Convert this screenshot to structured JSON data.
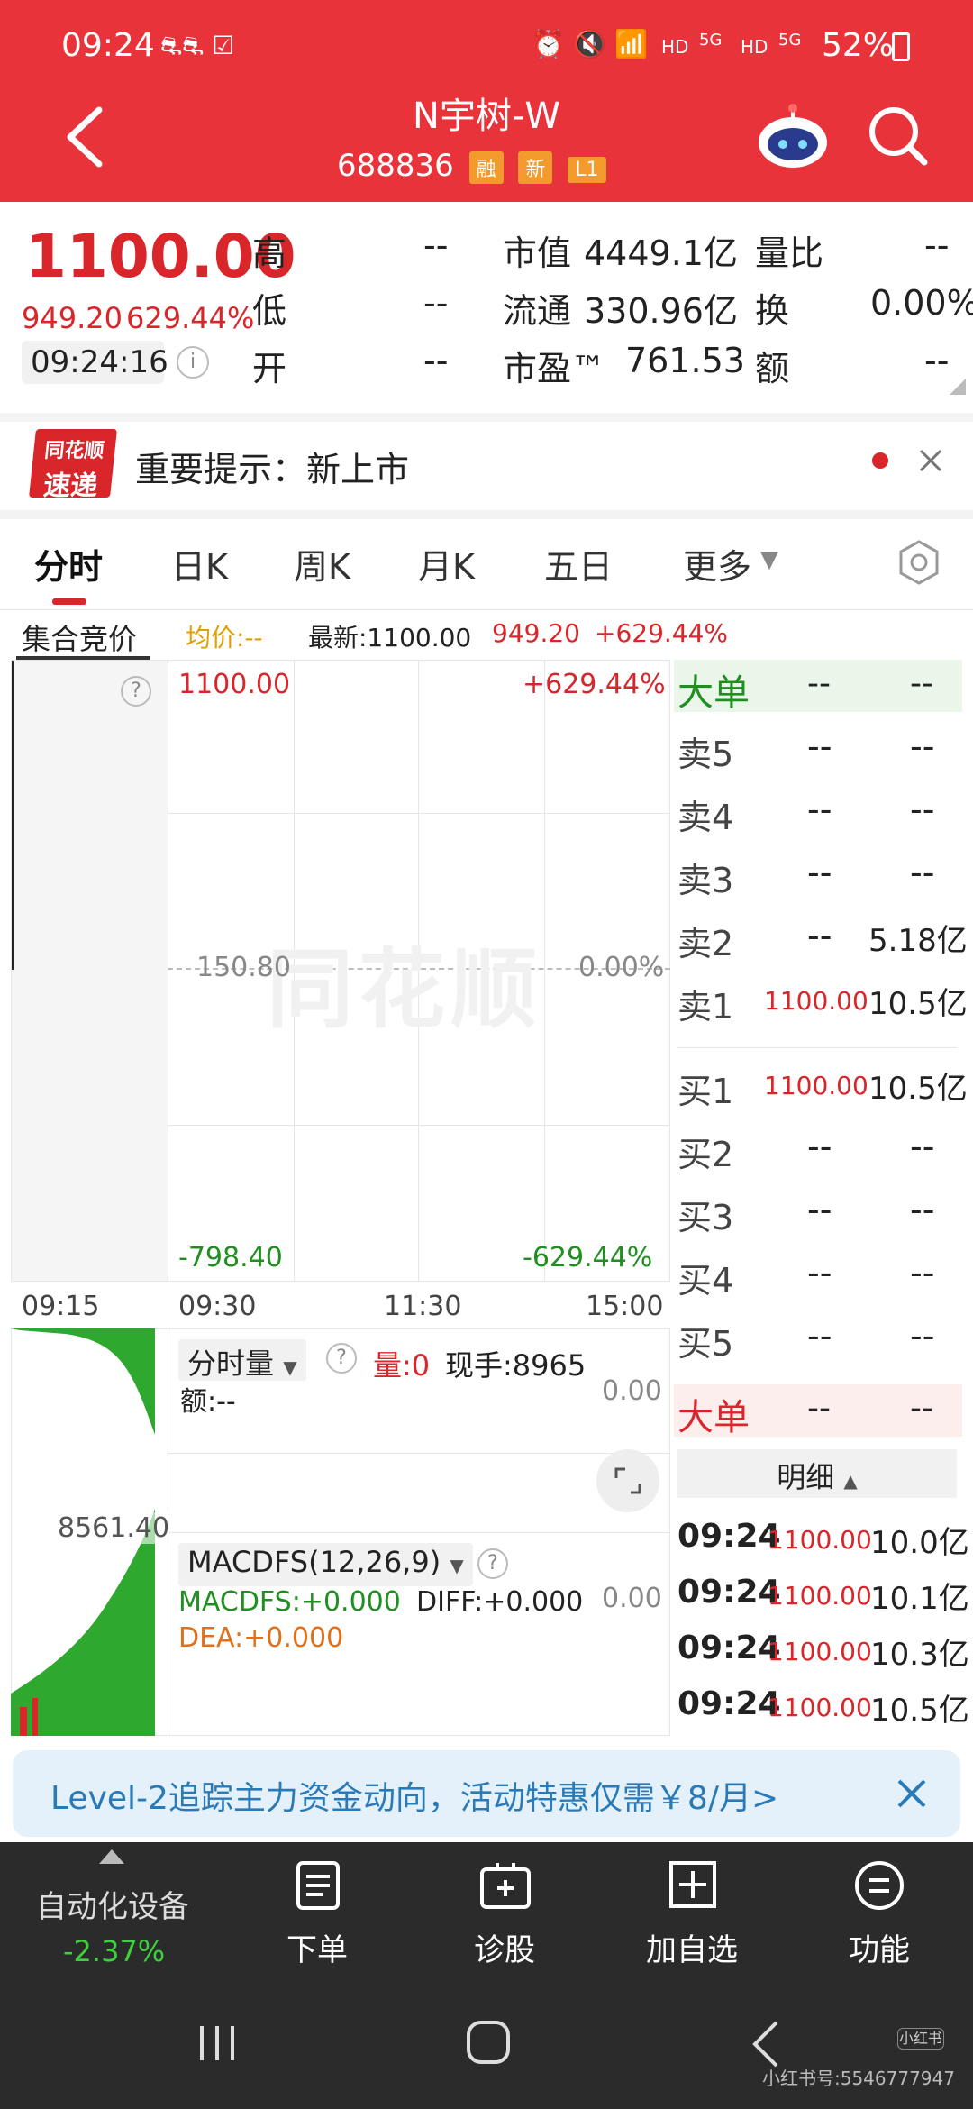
{
  "status_bar": {
    "time": "09:24",
    "hd1": "HD",
    "net1": "5G",
    "hd2": "HD",
    "net2": "5G",
    "battery": "52%"
  },
  "header": {
    "title": "N宇树-W",
    "code": "688836",
    "tags": [
      "融",
      "新",
      "L1"
    ]
  },
  "quote": {
    "price": "1100.00",
    "change": "949.20",
    "change_pct": "629.44%",
    "time": "09:24:16",
    "rows": [
      {
        "l1": "高",
        "v1": "--",
        "l2": "市值",
        "v2": "4449.1亿",
        "l3": "量比",
        "v3": "--"
      },
      {
        "l1": "低",
        "v1": "--",
        "l2": "流通",
        "v2": "330.96亿",
        "l3": "换",
        "v3": "0.00%"
      },
      {
        "l1": "开",
        "v1": "--",
        "l2": "市盈™",
        "v2": "761.53",
        "l3": "额",
        "v3": "--"
      }
    ]
  },
  "news": {
    "logo_top": "同花顺",
    "logo_bottom": "速递",
    "text": "重要提示：新上市"
  },
  "tabs": [
    "分时",
    "日K",
    "周K",
    "月K",
    "五日",
    "更多"
  ],
  "info_bar": {
    "auction": "集合竞价",
    "avg": "均价:--",
    "latest": "最新:1100.00",
    "change": "949.20",
    "pct": "+629.44%"
  },
  "chart": {
    "y_top": "1100.00",
    "y_top_pct": "+629.44%",
    "y_mid": "150.80",
    "y_mid_pct": "0.00%",
    "y_bot": "-798.40",
    "y_bot_pct": "-629.44%",
    "watermark": "同花顺",
    "x_labels": [
      "09:15",
      "09:30",
      "11:30",
      "15:00"
    ]
  },
  "volume_panel": {
    "selector": "分时量",
    "vol": "量:0",
    "hand": "现手:8965",
    "amount": "额:--",
    "value": "0.00",
    "left_value": "8561.40"
  },
  "macd_panel": {
    "selector": "MACDFS(12,26,9)",
    "macdfs": "MACDFS:+0.000",
    "diff": "DIFF:+0.000",
    "dea": "DEA:+0.000",
    "value": "0.00"
  },
  "order_book": {
    "big_top": {
      "label": "大单",
      "a": "--",
      "b": "--"
    },
    "asks": [
      {
        "label": "卖5",
        "price": "--",
        "vol": "--"
      },
      {
        "label": "卖4",
        "price": "--",
        "vol": "--"
      },
      {
        "label": "卖3",
        "price": "--",
        "vol": "--"
      },
      {
        "label": "卖2",
        "price": "--",
        "vol": "5.18亿"
      },
      {
        "label": "卖1",
        "price": "1100.00",
        "vol": "10.5亿"
      }
    ],
    "bids": [
      {
        "label": "买1",
        "price": "1100.00",
        "vol": "10.5亿"
      },
      {
        "label": "买2",
        "price": "--",
        "vol": "--"
      },
      {
        "label": "买3",
        "price": "--",
        "vol": "--"
      },
      {
        "label": "买4",
        "price": "--",
        "vol": "--"
      },
      {
        "label": "买5",
        "price": "--",
        "vol": "--"
      }
    ],
    "big_bottom": {
      "label": "大单",
      "a": "--",
      "b": "--"
    },
    "detail_label": "明细",
    "ticks": [
      {
        "time": "09:24",
        "price": "1100.00",
        "amt": "10.0亿"
      },
      {
        "time": "09:24",
        "price": "1100.00",
        "amt": "10.1亿"
      },
      {
        "time": "09:24",
        "price": "1100.00",
        "amt": "10.3亿"
      },
      {
        "time": "09:24",
        "price": "1100.00",
        "amt": "10.5亿"
      }
    ]
  },
  "promo": {
    "text": "Level-2追踪主力资金动向，活动特惠仅需￥8/月>"
  },
  "bottom_nav": {
    "sector": "自动化设备",
    "sector_pct": "-2.37%",
    "items": [
      "下单",
      "诊股",
      "加自选",
      "功能"
    ]
  },
  "watermark_text": "小红书号:5546777947",
  "watermark_logo": "小红书",
  "colors": {
    "header_red": "#e8333a",
    "up_red": "#d9262b",
    "down_green": "#1f8f1f",
    "nav_bg": "#2b2b2b"
  }
}
